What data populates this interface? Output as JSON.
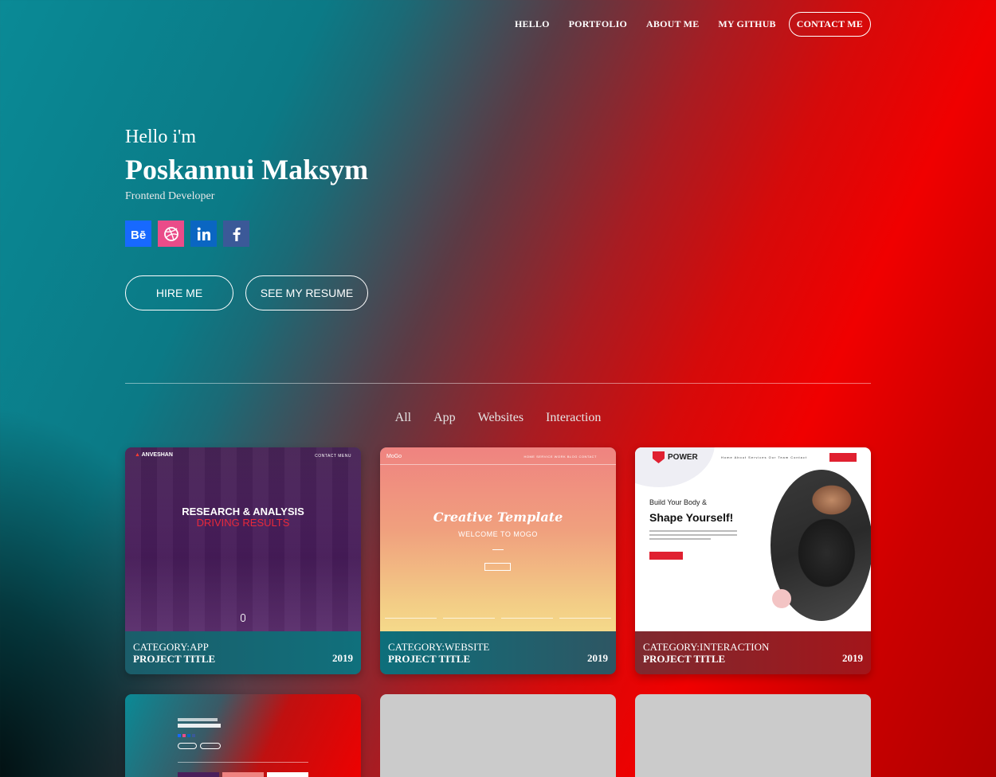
{
  "nav": {
    "items": [
      "HELLO",
      "PORTFOLIO",
      "ABOUT ME",
      "MY GITHUB"
    ],
    "contact": "CONTACT ME"
  },
  "hero": {
    "greeting": "Hello i'm",
    "name": "Poskannui Maksym",
    "role": "Frontend Developer",
    "socials": [
      {
        "icon": "behance-icon",
        "color": "#1769ff"
      },
      {
        "icon": "dribbble-icon",
        "color": "#ea4c89"
      },
      {
        "icon": "linkedin-icon",
        "color": "#0a66c2"
      },
      {
        "icon": "facebook-icon",
        "color": "#3b5998"
      }
    ],
    "hire_label": "HIRE ME",
    "resume_label": "SEE MY RESUME"
  },
  "filters": [
    "All",
    "App",
    "Websites",
    "Interaction"
  ],
  "cards": [
    {
      "category": "CATEGORY:APP",
      "title": "PROJECT TITLE",
      "year": "2019",
      "preview": {
        "logo": "ANVESHAN",
        "menu": "CONTACT   MENU",
        "line1": "RESEARCH & ANALYSIS",
        "line2": "DRIVING RESULTS"
      }
    },
    {
      "category": "CATEGORY:WEBSITE",
      "title": "PROJECT TITLE",
      "year": "2019",
      "preview": {
        "logo": "MoGo",
        "menu": "HOME   SERVICE   WORK   BLOG   CONTACT",
        "line1": "Creative Template",
        "line2": "WELCOME TO MOGO"
      }
    },
    {
      "category": "CATEGORY:INTERACTION",
      "title": "PROJECT TITLE",
      "year": "2019",
      "preview": {
        "logo": "POWER",
        "menu": "Home  About  Services  Our Team  Contact",
        "line1": "Build Your Body &",
        "line2": "Shape Yourself!"
      }
    }
  ],
  "colors": {
    "accent_red": "#f00000",
    "accent_teal": "#0a8a96",
    "placeholder": "#cbcbcb"
  }
}
